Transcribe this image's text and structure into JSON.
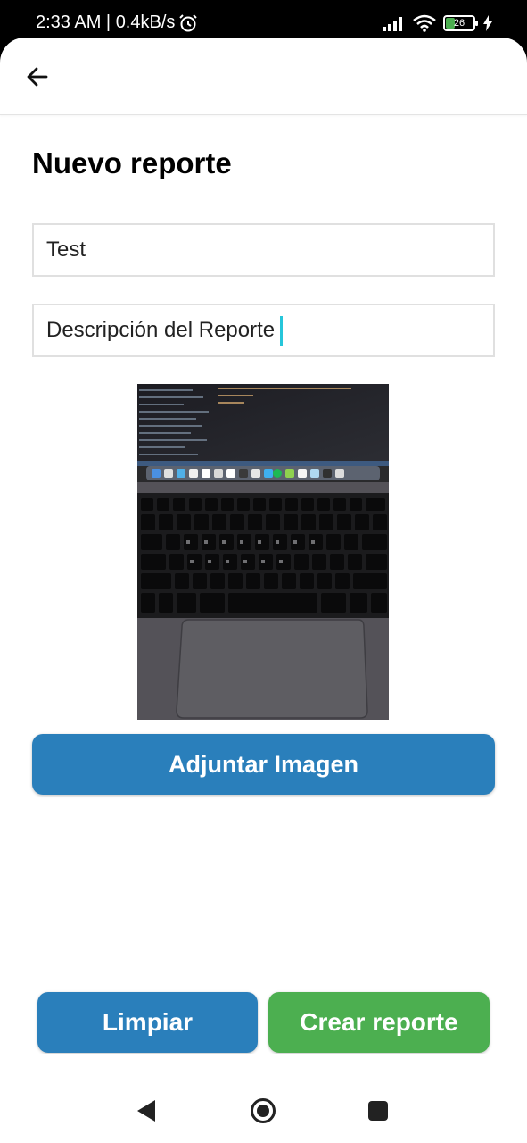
{
  "status_bar": {
    "time_speed": "2:33 AM | 0.4kB/s",
    "battery_level": "26",
    "icons": [
      "alarm-icon",
      "signal-icon",
      "wifi-icon",
      "battery-icon",
      "charging-icon"
    ]
  },
  "app_bar": {
    "back_icon": "arrow-left-icon"
  },
  "page": {
    "title": "Nuevo reporte"
  },
  "form": {
    "title_value": "Test",
    "description_value": "Descripción del Reporte"
  },
  "buttons": {
    "attach_label": "Adjuntar Imagen",
    "clear_label": "Limpiar",
    "create_label": "Crear reporte"
  },
  "colors": {
    "primary": "#2a7fbb",
    "success": "#4caf50",
    "caret": "#26c6da"
  },
  "nav_bar": {
    "icons": [
      "nav-back-icon",
      "nav-home-icon",
      "nav-recents-icon"
    ]
  }
}
